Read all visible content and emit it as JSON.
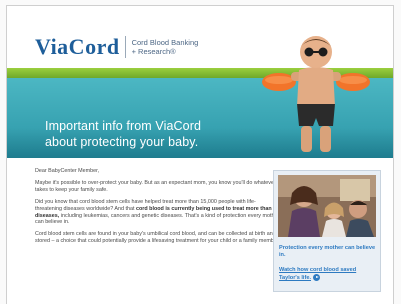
{
  "header": {
    "logo": "ViaCord",
    "tagline_line1": "Cord Blood Banking",
    "tagline_line2": "+ Research®"
  },
  "hero": {
    "headline_line1": "Important info from ViaCord",
    "headline_line2": "about protecting your baby."
  },
  "body": {
    "greeting": "Dear BabyCenter Member,",
    "p1": "Maybe it's possible to over-protect your baby. But as an expectant mom, you know you'll do whatever it takes to keep your family safe.",
    "p2_start": "Did you know that cord blood stem cells have helped treat more than 15,000 people with life-threatening diseases worldwide? And that ",
    "p2_bold": "cord blood is currently being used to treat more than 70 diseases,",
    "p2_end": " including leukemias, cancers and genetic diseases. That's a kind of protection every mother can believe in.",
    "p3": "Cord blood stem cells are found in your baby's umbilical cord blood, and can be collected at birth and stored – a choice that could potentially provide a lifesaving treatment for your child or a family member."
  },
  "panel": {
    "title": "Protection every mother can believe in.",
    "link": "Watch how cord blood saved Taylor's life."
  },
  "colors": {
    "brand_blue": "#1e5e9a",
    "green_bar": "#8cc63f",
    "teal": "#3aa9b8",
    "link_blue": "#2d7ac1"
  },
  "icons": [
    "play-icon"
  ]
}
